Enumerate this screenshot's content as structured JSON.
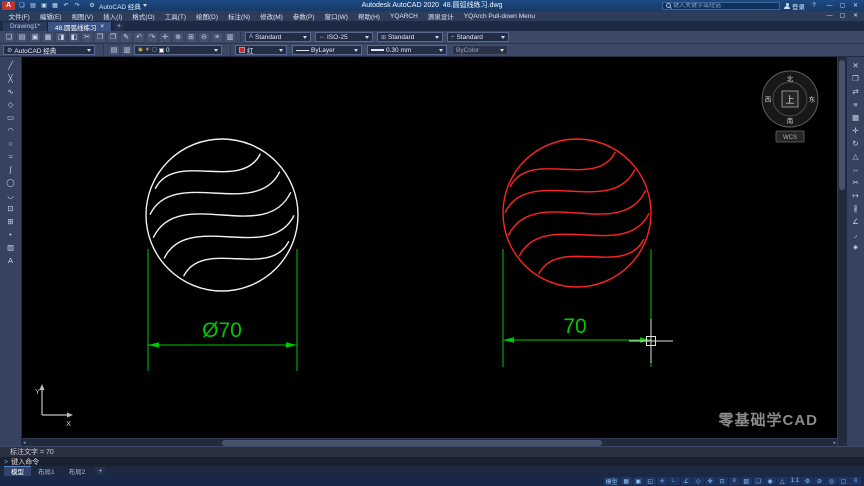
{
  "titlebar": {
    "logo": "A",
    "gear_glyph": "⚙",
    "quick_icons": [
      {
        "name": "new-file-icon",
        "glyph": "❏"
      },
      {
        "name": "open-file-icon",
        "glyph": "▤"
      },
      {
        "name": "save-icon",
        "glyph": "▣"
      },
      {
        "name": "plot-icon",
        "glyph": "▦"
      },
      {
        "name": "undo-icon",
        "glyph": "↶"
      },
      {
        "name": "redo-icon",
        "glyph": "↷"
      }
    ],
    "workspace": "AutoCAD 经典",
    "title": "Autodesk AutoCAD 2020  48.圆弧线练习.dwg",
    "search_placeholder": "键入关键字或短语",
    "signin": "登录",
    "help": "?",
    "window_controls": [
      {
        "name": "minimize-button",
        "glyph": "—"
      },
      {
        "name": "restore-button",
        "glyph": "▢"
      },
      {
        "name": "close-button",
        "glyph": "✕"
      }
    ]
  },
  "menubar": {
    "items": [
      "文件(F)",
      "编辑(E)",
      "视图(V)",
      "插入(I)",
      "格式(O)",
      "工具(T)",
      "绘图(D)",
      "标注(N)",
      "修改(M)",
      "参数(P)",
      "窗口(W)",
      "帮助(H)",
      "YQARCH",
      "源泉设计",
      "YQArch Pull-down Menu"
    ],
    "window_controls": [
      {
        "name": "doc-minimize-button",
        "glyph": "—"
      },
      {
        "name": "doc-restore-button",
        "glyph": "▢"
      },
      {
        "name": "doc-close-button",
        "glyph": "✕"
      }
    ]
  },
  "filetabs": {
    "tabs": [
      {
        "label": "Drawing1*"
      },
      {
        "label": "48.圆弧线练习"
      }
    ],
    "close_glyph": "×",
    "add_tab": "+"
  },
  "toolbar1": {
    "icons": [
      {
        "name": "qnew-icon",
        "glyph": "❏"
      },
      {
        "name": "open-icon",
        "glyph": "▤"
      },
      {
        "name": "save-file-icon",
        "glyph": "▣"
      },
      {
        "name": "plot-icon",
        "glyph": "▦"
      },
      {
        "name": "plot-preview-icon",
        "glyph": "◨"
      },
      {
        "name": "publish-icon",
        "glyph": "◧"
      },
      {
        "name": "cut-icon",
        "glyph": "✂"
      },
      {
        "name": "copy-clip-icon",
        "glyph": "❐"
      },
      {
        "name": "paste-icon",
        "glyph": "❒"
      },
      {
        "name": "match-properties-icon",
        "glyph": "✎"
      },
      {
        "name": "undo-arrow-icon",
        "glyph": "↶"
      },
      {
        "name": "redo-arrow-icon",
        "glyph": "↷"
      },
      {
        "name": "pan-icon",
        "glyph": "✛"
      },
      {
        "name": "zoom-realtime-icon",
        "glyph": "⊕"
      },
      {
        "name": "zoom-window-icon",
        "glyph": "⊞"
      },
      {
        "name": "zoom-previous-icon",
        "glyph": "⊖"
      },
      {
        "name": "properties-icon",
        "glyph": "≡"
      },
      {
        "name": "designcenter-icon",
        "glyph": "▥"
      }
    ],
    "styles": [
      {
        "name": "text-style-select",
        "glyph": "A",
        "label": "Standard"
      },
      {
        "name": "dim-style-select",
        "glyph": "↔",
        "label": "ISO-25"
      },
      {
        "name": "table-style-select",
        "glyph": "⊞",
        "label": "Standard"
      },
      {
        "name": "mleader-style-select",
        "glyph": "⌐",
        "label": "Standard"
      }
    ]
  },
  "toolbar2": {
    "workspace": "AutoCAD 经典",
    "layer_tools": [
      {
        "name": "layer-properties-icon",
        "glyph": "▤"
      },
      {
        "name": "layer-states-icon",
        "glyph": "▥"
      }
    ],
    "layer": {
      "bulb": "◉",
      "sun": "☀",
      "lock": "▢",
      "value": "0"
    },
    "color_value": "红",
    "linetype_value": "ByLayer",
    "lineweight_value": "0.30 mm",
    "plotstyle_value": "ByColor"
  },
  "leftdock": {
    "tools": [
      {
        "name": "line-tool-icon",
        "glyph": "╱"
      },
      {
        "name": "construction-line-tool-icon",
        "glyph": "╳"
      },
      {
        "name": "polyline-tool-icon",
        "glyph": "∿"
      },
      {
        "name": "polygon-tool-icon",
        "glyph": "◇"
      },
      {
        "name": "rectangle-tool-icon",
        "glyph": "▭"
      },
      {
        "name": "arc-tool-icon",
        "glyph": "◠"
      },
      {
        "name": "circle-tool-icon",
        "glyph": "○"
      },
      {
        "name": "revision-cloud-tool-icon",
        "glyph": "≈"
      },
      {
        "name": "spline-tool-icon",
        "glyph": "∫"
      },
      {
        "name": "ellipse-tool-icon",
        "glyph": "◯"
      },
      {
        "name": "ellipse-arc-tool-icon",
        "glyph": "◡"
      },
      {
        "name": "insert-block-tool-icon",
        "glyph": "⊡"
      },
      {
        "name": "make-block-tool-icon",
        "glyph": "⊞"
      },
      {
        "name": "point-tool-icon",
        "glyph": "•"
      },
      {
        "name": "hatch-tool-icon",
        "glyph": "▨"
      },
      {
        "name": "mtext-tool-icon",
        "glyph": "A"
      }
    ]
  },
  "rightdock": {
    "tools": [
      {
        "name": "erase-tool-icon",
        "glyph": "✕"
      },
      {
        "name": "copy-tool-icon",
        "glyph": "❐"
      },
      {
        "name": "mirror-tool-icon",
        "glyph": "⇄"
      },
      {
        "name": "offset-tool-icon",
        "glyph": "≡"
      },
      {
        "name": "array-tool-icon",
        "glyph": "▦"
      },
      {
        "name": "move-tool-icon",
        "glyph": "✛"
      },
      {
        "name": "rotate-tool-icon",
        "glyph": "↻"
      },
      {
        "name": "scale-tool-icon",
        "glyph": "△"
      },
      {
        "name": "stretch-tool-icon",
        "glyph": "↔"
      },
      {
        "name": "trim-tool-icon",
        "glyph": "✂"
      },
      {
        "name": "extend-tool-icon",
        "glyph": "↦"
      },
      {
        "name": "break-tool-icon",
        "glyph": "∦"
      },
      {
        "name": "chamfer-tool-icon",
        "glyph": "∠"
      },
      {
        "name": "fillet-tool-icon",
        "glyph": "◞"
      },
      {
        "name": "explode-tool-icon",
        "glyph": "✷"
      }
    ]
  },
  "canvas": {
    "dim_left": "Ø70",
    "dim_right": "70",
    "compass": {
      "north": "北",
      "south": "南",
      "west": "西",
      "east": "东",
      "center": "上",
      "wcs": "WCS"
    },
    "ucs": {
      "x_label": "X",
      "y_label": "Y"
    },
    "watermark": "零基础学CAD",
    "colors": {
      "dimension": "#00c800",
      "left_circle": "#f0f0f0",
      "right_circle": "#ff2323",
      "crosshair": "#e0e0e0"
    }
  },
  "command": {
    "history": "标注文字 = 70",
    "prompt_symbol": ">",
    "prompt": "键入命令"
  },
  "layoutbar": {
    "tabs": [
      {
        "label": "模型"
      },
      {
        "label": "布局1"
      },
      {
        "label": "布局2"
      }
    ],
    "add": "+"
  },
  "statusbar": {
    "items": [
      {
        "name": "model-space-button",
        "glyph": "模型"
      },
      {
        "name": "grid-icon",
        "glyph": "▦"
      },
      {
        "name": "snap-icon",
        "glyph": "▣"
      },
      {
        "name": "infer-constraints-icon",
        "glyph": "◱"
      },
      {
        "name": "dynamic-input-icon",
        "glyph": "✛"
      },
      {
        "name": "ortho-icon",
        "glyph": "∟"
      },
      {
        "name": "polar-tracking-icon",
        "glyph": "∠"
      },
      {
        "name": "isodraft-icon",
        "glyph": "◇"
      },
      {
        "name": "osnap-tracking-icon",
        "glyph": "✜"
      },
      {
        "name": "osnap-icon",
        "glyph": "⊡"
      },
      {
        "name": "lineweight-display-icon",
        "glyph": "≡"
      },
      {
        "name": "transparency-icon",
        "glyph": "▨"
      },
      {
        "name": "selection-cycling-icon",
        "glyph": "❏"
      },
      {
        "name": "annotation-visibility-icon",
        "glyph": "◉"
      },
      {
        "name": "autoscale-icon",
        "glyph": "△"
      },
      {
        "name": "annotation-scale-label",
        "glyph": "1:1"
      },
      {
        "name": "workspace-switching-icon",
        "glyph": "⚙"
      },
      {
        "name": "annotation-monitor-icon",
        "glyph": "⊘"
      },
      {
        "name": "isolate-objects-icon",
        "glyph": "◎"
      },
      {
        "name": "clean-screen-icon",
        "glyph": "▢"
      },
      {
        "name": "customize-icon",
        "glyph": "≡"
      }
    ]
  }
}
